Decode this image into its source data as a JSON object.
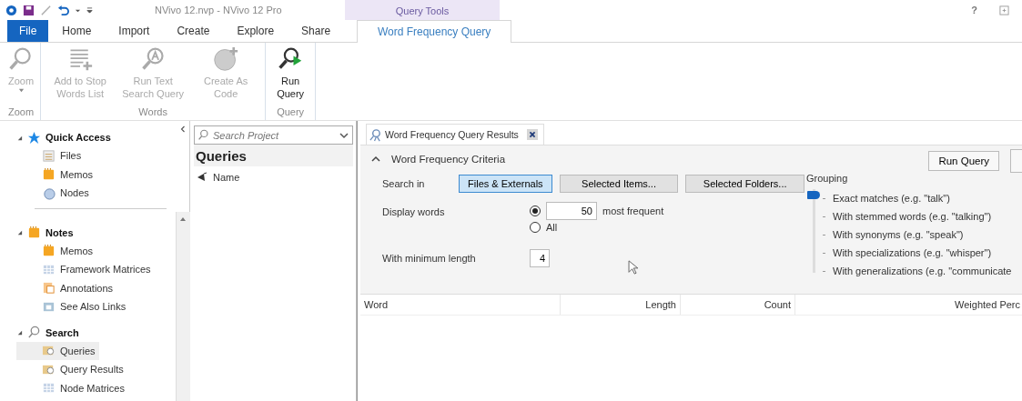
{
  "window": {
    "title": "NVivo 12.nvp - NVivo 12 Pro",
    "context_tab_group": "Query Tools",
    "help": "?"
  },
  "ribbon_tabs": [
    {
      "label": "File",
      "kind": "file",
      "selected": false
    },
    {
      "label": "Home",
      "kind": "tab",
      "selected": false
    },
    {
      "label": "Import",
      "kind": "tab",
      "selected": false
    },
    {
      "label": "Create",
      "kind": "tab",
      "selected": false
    },
    {
      "label": "Explore",
      "kind": "tab",
      "selected": false
    },
    {
      "label": "Share",
      "kind": "tab",
      "selected": false
    },
    {
      "label": "Word Frequency Query",
      "kind": "context",
      "selected": true
    }
  ],
  "ribbon_groups": [
    {
      "label": "Zoom",
      "buttons": [
        {
          "label": "Zoom",
          "disabled": true,
          "dropdown": true
        }
      ]
    },
    {
      "label": "Words",
      "buttons": [
        {
          "label": "Add to Stop Words List",
          "disabled": true,
          "dropdown": false
        },
        {
          "label": "Run Text Search Query",
          "disabled": true,
          "dropdown": false
        },
        {
          "label": "Create As Code",
          "disabled": true,
          "dropdown": false
        }
      ]
    },
    {
      "label": "Query",
      "buttons": [
        {
          "label": "Run Query",
          "disabled": false,
          "dropdown": false
        }
      ]
    }
  ],
  "navigation": [
    {
      "label": "Quick Access",
      "expanded": true,
      "children": [
        {
          "label": "Files",
          "selected": false
        },
        {
          "label": "Memos",
          "selected": false
        },
        {
          "label": "Nodes",
          "selected": false
        }
      ]
    },
    {
      "label": "Notes",
      "expanded": true,
      "children": [
        {
          "label": "Memos",
          "selected": false
        },
        {
          "label": "Framework Matrices",
          "selected": false
        },
        {
          "label": "Annotations",
          "selected": false
        },
        {
          "label": "See Also Links",
          "selected": false
        }
      ]
    },
    {
      "label": "Search",
      "expanded": true,
      "children": [
        {
          "label": "Queries",
          "selected": true
        },
        {
          "label": "Query Results",
          "selected": false
        },
        {
          "label": "Node Matrices",
          "selected": false
        }
      ]
    }
  ],
  "list_view": {
    "search": {
      "placeholder": "Search Project"
    },
    "title": "Queries",
    "columns": [
      "Name"
    ]
  },
  "detail_tab": {
    "label": "Word Frequency Query Results"
  },
  "criteria": {
    "title": "Word Frequency Criteria",
    "expanded": true,
    "search_in": {
      "label": "Search in",
      "options": [
        {
          "label": "Files & Externals",
          "selected": true
        },
        {
          "label": "Selected Items...",
          "selected": false
        },
        {
          "label": "Selected Folders...",
          "selected": false
        }
      ]
    },
    "display_words": {
      "label": "Display words",
      "options": [
        {
          "kind": "count",
          "selected": true,
          "value": "50",
          "suffix": "most frequent"
        },
        {
          "kind": "all",
          "selected": false,
          "label": "All"
        }
      ]
    },
    "min_length": {
      "label": "With minimum length",
      "value": "4"
    },
    "run_button": "Run Query",
    "grouping": {
      "label": "Grouping",
      "options": [
        {
          "label": "Exact matches (e.g. \"talk\")",
          "selected": true
        },
        {
          "label": "With stemmed words (e.g. \"talking\")",
          "selected": false
        },
        {
          "label": "With synonyms (e.g. \"speak\")",
          "selected": false
        },
        {
          "label": "With specializations (e.g. \"whisper\")",
          "selected": false
        },
        {
          "label": "With generalizations (e.g. \"communicate",
          "selected": false
        }
      ]
    }
  },
  "results": {
    "columns": [
      "Word",
      "Length",
      "Count",
      "Weighted Perc"
    ]
  }
}
